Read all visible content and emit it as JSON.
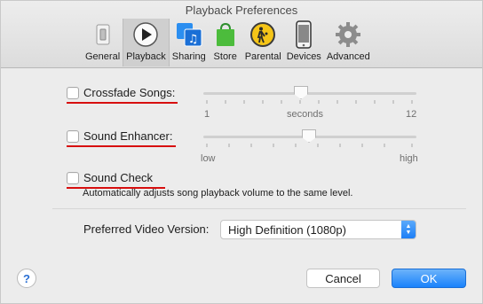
{
  "window": {
    "title": "Playback Preferences"
  },
  "toolbar": {
    "items": [
      {
        "label": "General",
        "icon": "general-switch-icon"
      },
      {
        "label": "Playback",
        "icon": "play-icon",
        "selected": true
      },
      {
        "label": "Sharing",
        "icon": "sharing-icon"
      },
      {
        "label": "Store",
        "icon": "store-bag-icon"
      },
      {
        "label": "Parental",
        "icon": "parental-icon"
      },
      {
        "label": "Devices",
        "icon": "device-phone-icon"
      },
      {
        "label": "Advanced",
        "icon": "gear-icon"
      }
    ]
  },
  "settings": {
    "crossfade": {
      "label": "Crossfade Songs:",
      "checked": false,
      "slider": {
        "min_label": "1",
        "mid_label": "seconds",
        "max_label": "12",
        "value": 6
      }
    },
    "enhancer": {
      "label": "Sound Enhancer:",
      "checked": false,
      "slider": {
        "min_label": "low",
        "max_label": "high",
        "value": 0.5
      }
    },
    "sound_check": {
      "label": "Sound Check",
      "checked": false,
      "description": "Automatically adjusts song playback volume to the same level."
    }
  },
  "video": {
    "label": "Preferred Video Version:",
    "selected": "High Definition (1080p)"
  },
  "buttons": {
    "help": "?",
    "cancel": "Cancel",
    "ok": "OK"
  },
  "colors": {
    "annotation_underline": "#d70f0f",
    "accent": "#1a82fb"
  }
}
